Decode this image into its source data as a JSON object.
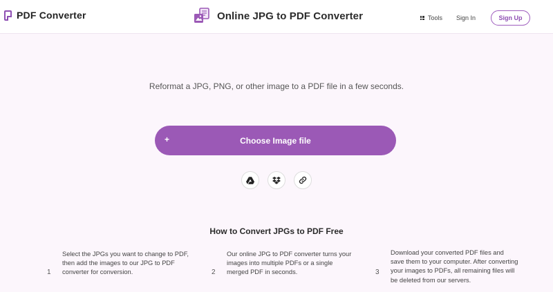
{
  "header": {
    "logo_text": "PDF Converter",
    "title": "Online JPG to PDF Converter",
    "tools_label": "Tools",
    "sign_in_label": "Sign In",
    "sign_up_label": "Sign Up"
  },
  "main": {
    "subtitle": "Reformat a JPG, PNG, or other image to a PDF file in a few seconds.",
    "choose_button_plus": "+",
    "choose_button_label": "Choose Image file",
    "sources": [
      {
        "icon": "google-drive-icon"
      },
      {
        "icon": "dropbox-icon"
      },
      {
        "icon": "link-icon"
      }
    ]
  },
  "how_to": {
    "title": "How to Convert JPGs to PDF Free",
    "steps": [
      {
        "num": "1",
        "text": "Select the JPGs you want to change to PDF, then add the images to our JPG to PDF converter for conversion."
      },
      {
        "num": "2",
        "text": "Our online JPG to PDF converter turns your images into multiple PDFs or a single merged PDF in seconds."
      },
      {
        "num": "3",
        "text": "Download your converted PDF files and save them to your computer. After converting your images to PDFs, all remaining files will be deleted from our servers."
      }
    ]
  },
  "colors": {
    "accent": "#9b59b6",
    "background": "#fcf6fc"
  }
}
